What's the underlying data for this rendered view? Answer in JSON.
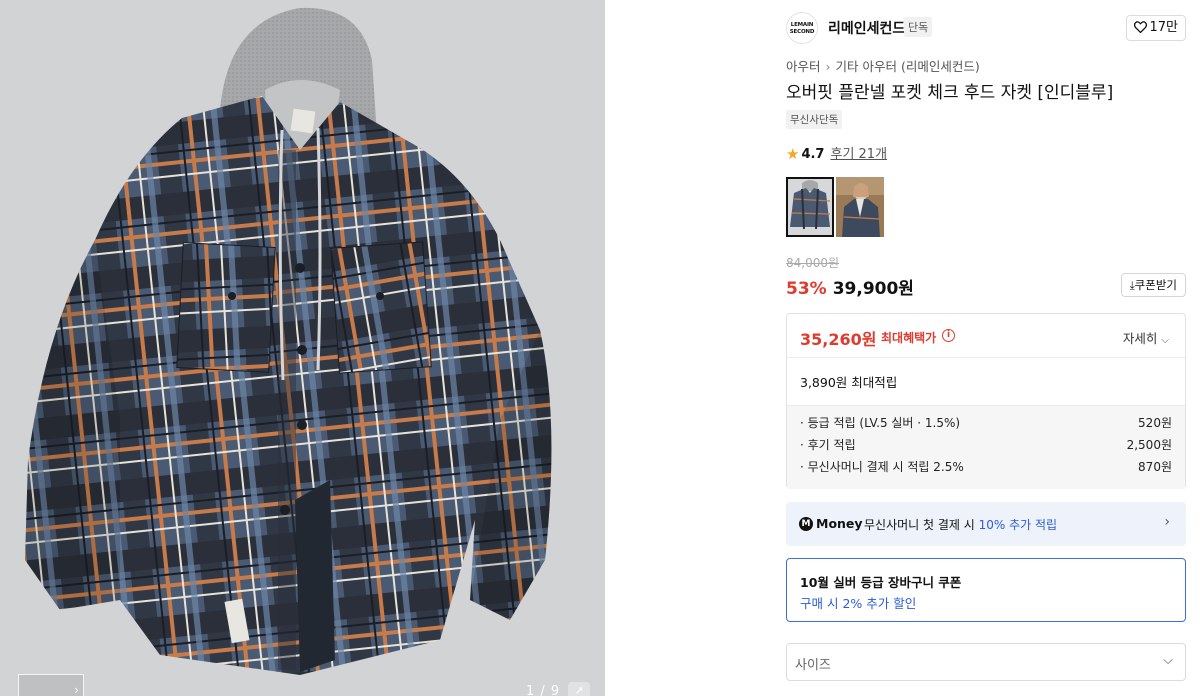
{
  "gallery": {
    "counter": "1 / 9",
    "expand_icon": "expand-icon",
    "next_icon": "chevron-right-icon"
  },
  "brand": {
    "logo_text": "LEMAIN SECOND",
    "name": "리메인세컨드",
    "exclusive_tag": "단독",
    "likes": "17만"
  },
  "breadcrumb": [
    "아우터",
    "기타 아우터 (리메인세컨드)"
  ],
  "product": {
    "title": "오버핏 플란넬 포켓 체크 후드 자켓 [인디블루]",
    "store_tag": "무신사단독",
    "rating": "4.7",
    "reviews": "후기 21개"
  },
  "price": {
    "original": "84,000원",
    "discount_rate": "53%",
    "sale": "39,900원",
    "coupon_button": "쿠폰받기"
  },
  "benefit": {
    "max_price": "35,260원",
    "max_label": "최대혜택가",
    "toggle_label": "자세히",
    "points_total": "3,890원 최대적립",
    "rows": [
      {
        "label": "· 등급 적립 (LV.5 실버 · 1.5%)",
        "value": "520원"
      },
      {
        "label": "· 후기 적립",
        "value": "2,500원"
      },
      {
        "label": "· 무신사머니 결제 시 적립 2.5%",
        "value": "870원"
      }
    ]
  },
  "money_banner": {
    "logo": "M",
    "brand": "Money",
    "text": "무신사머니 첫 결제 시",
    "highlight": "10% 추가 적립"
  },
  "coupon_box": {
    "title": "10월 실버 등급 장바구니 쿠폰",
    "subtitle": "구매 시 2% 추가 할인"
  },
  "size_select": {
    "placeholder": "사이즈"
  },
  "colors": {
    "accent_red": "#e13b2f",
    "accent_blue": "#2b5bd7",
    "banner_bg": "#eef2fb"
  }
}
